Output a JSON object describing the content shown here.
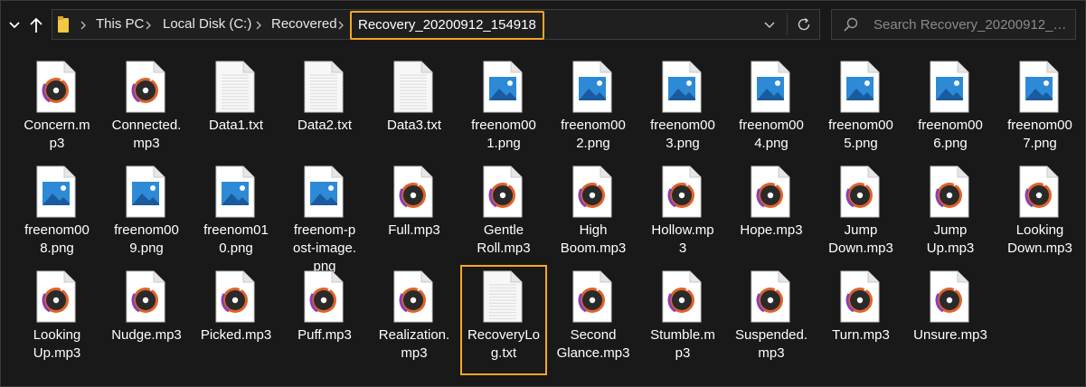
{
  "breadcrumb": {
    "items": [
      "This PC",
      "Local Disk (C:)",
      "Recovered"
    ],
    "current": "Recovery_20200912_154918"
  },
  "search": {
    "placeholder": "Search Recovery_20200912_154..."
  },
  "files": [
    {
      "name": "Concern.mp3",
      "type": "audio",
      "lines": [
        "Concern.m",
        "p3"
      ]
    },
    {
      "name": "Connected.mp3",
      "type": "audio",
      "lines": [
        "Connected.",
        "mp3"
      ]
    },
    {
      "name": "Data1.txt",
      "type": "text",
      "lines": [
        "Data1.txt"
      ]
    },
    {
      "name": "Data2.txt",
      "type": "text",
      "lines": [
        "Data2.txt"
      ]
    },
    {
      "name": "Data3.txt",
      "type": "text",
      "lines": [
        "Data3.txt"
      ]
    },
    {
      "name": "freenom001.png",
      "type": "image",
      "lines": [
        "freenom00",
        "1.png"
      ]
    },
    {
      "name": "freenom002.png",
      "type": "image",
      "lines": [
        "freenom00",
        "2.png"
      ]
    },
    {
      "name": "freenom003.png",
      "type": "image",
      "lines": [
        "freenom00",
        "3.png"
      ]
    },
    {
      "name": "freenom004.png",
      "type": "image",
      "lines": [
        "freenom00",
        "4.png"
      ]
    },
    {
      "name": "freenom005.png",
      "type": "image",
      "lines": [
        "freenom00",
        "5.png"
      ]
    },
    {
      "name": "freenom006.png",
      "type": "image",
      "lines": [
        "freenom00",
        "6.png"
      ]
    },
    {
      "name": "freenom007.png",
      "type": "image",
      "lines": [
        "freenom00",
        "7.png"
      ]
    },
    {
      "name": "freenom008.png",
      "type": "image",
      "lines": [
        "freenom00",
        "8.png"
      ]
    },
    {
      "name": "freenom009.png",
      "type": "image",
      "lines": [
        "freenom00",
        "9.png"
      ]
    },
    {
      "name": "freenom010.png",
      "type": "image",
      "lines": [
        "freenom01",
        "0.png"
      ]
    },
    {
      "name": "freenom-post-image.png",
      "type": "image",
      "lines": [
        "freenom-p",
        "ost-image.",
        "png"
      ]
    },
    {
      "name": "Full.mp3",
      "type": "audio",
      "lines": [
        "Full.mp3"
      ]
    },
    {
      "name": "Gentle Roll.mp3",
      "type": "audio",
      "lines": [
        "Gentle",
        "Roll.mp3"
      ]
    },
    {
      "name": "High Boom.mp3",
      "type": "audio",
      "lines": [
        "High",
        "Boom.mp3"
      ]
    },
    {
      "name": "Hollow.mp3",
      "type": "audio",
      "lines": [
        "Hollow.mp",
        "3"
      ]
    },
    {
      "name": "Hope.mp3",
      "type": "audio",
      "lines": [
        "Hope.mp3"
      ]
    },
    {
      "name": "Jump Down.mp3",
      "type": "audio",
      "lines": [
        "Jump",
        "Down.mp3"
      ]
    },
    {
      "name": "Jump Up.mp3",
      "type": "audio",
      "lines": [
        "Jump",
        "Up.mp3"
      ]
    },
    {
      "name": "Looking Down.mp3",
      "type": "audio",
      "lines": [
        "Looking",
        "Down.mp3"
      ]
    },
    {
      "name": "Looking Up.mp3",
      "type": "audio",
      "lines": [
        "Looking",
        "Up.mp3"
      ]
    },
    {
      "name": "Nudge.mp3",
      "type": "audio",
      "lines": [
        "Nudge.mp3"
      ]
    },
    {
      "name": "Picked.mp3",
      "type": "audio",
      "lines": [
        "Picked.mp3"
      ]
    },
    {
      "name": "Puff.mp3",
      "type": "audio",
      "lines": [
        "Puff.mp3"
      ]
    },
    {
      "name": "Realization.mp3",
      "type": "audio",
      "lines": [
        "Realization.",
        "mp3"
      ]
    },
    {
      "name": "RecoveryLog.txt",
      "type": "text",
      "lines": [
        "RecoveryLo",
        "g.txt"
      ],
      "selected": true
    },
    {
      "name": "Second Glance.mp3",
      "type": "audio",
      "lines": [
        "Second",
        "Glance.mp3"
      ]
    },
    {
      "name": "Stumble.mp3",
      "type": "audio",
      "lines": [
        "Stumble.m",
        "p3"
      ]
    },
    {
      "name": "Suspended.mp3",
      "type": "audio",
      "lines": [
        "Suspended.",
        "mp3"
      ]
    },
    {
      "name": "Turn.mp3",
      "type": "audio",
      "lines": [
        "Turn.mp3"
      ]
    },
    {
      "name": "Unsure.mp3",
      "type": "audio",
      "lines": [
        "Unsure.mp3"
      ]
    }
  ],
  "colors": {
    "background": "#191919",
    "highlight": "#f5a623",
    "folder": "#f2c744",
    "image_icon": "#2d8ad6",
    "audio_ring": "#e0632a"
  },
  "icons": {
    "back": "chevron-down-icon",
    "up": "arrow-up-icon",
    "folder": "folder-icon",
    "separator": "chevron-right-icon",
    "dropdown": "chevron-down-icon",
    "refresh": "refresh-icon",
    "search": "search-icon"
  }
}
